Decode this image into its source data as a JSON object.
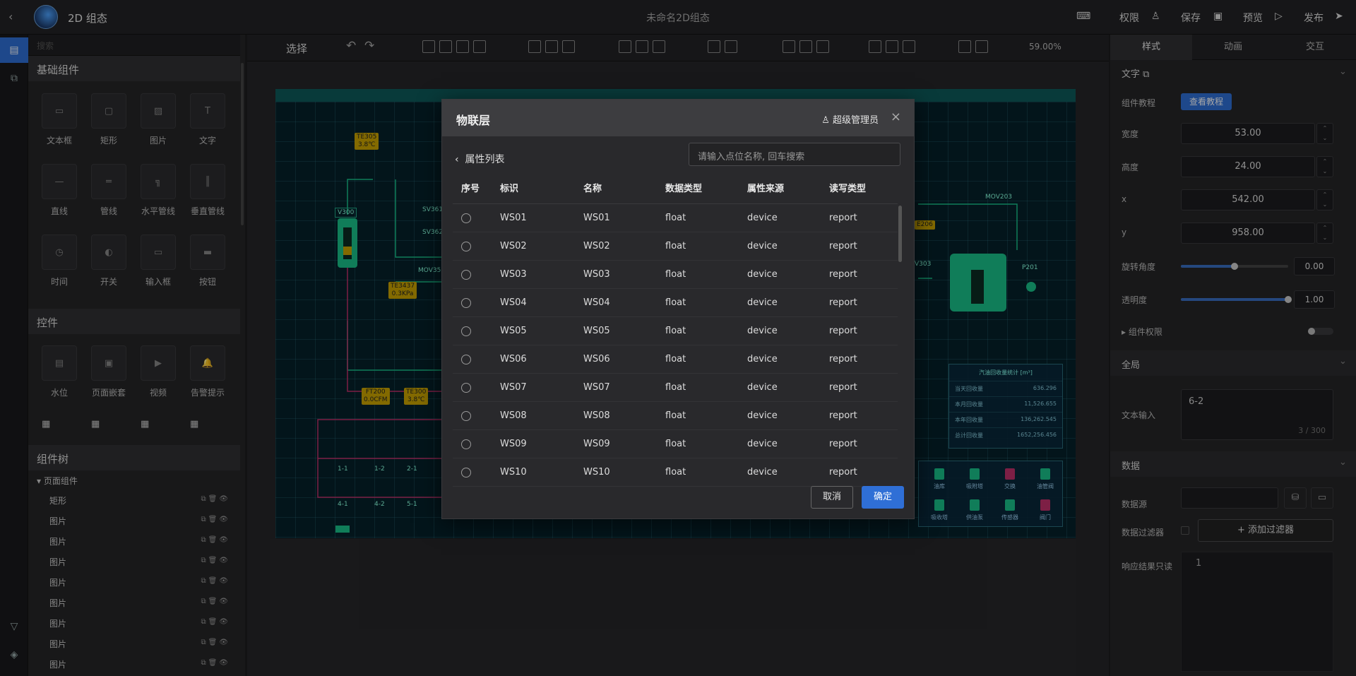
{
  "topbar": {
    "app_title": "2D 组态",
    "doc_title": "未命名2D组态",
    "permissions": "权限",
    "save": "保存",
    "preview": "预览",
    "publish": "发布"
  },
  "left": {
    "search_placeholder": "搜索",
    "basic_title": "基础组件",
    "basic_items": [
      "文本框",
      "矩形",
      "图片",
      "文字",
      "直线",
      "管线",
      "水平管线",
      "垂直管线",
      "时间",
      "开关",
      "输入框",
      "按钮"
    ],
    "controls_title": "控件",
    "control_items": [
      "水位",
      "页面嵌套",
      "视频",
      "告警提示"
    ],
    "tree_title": "组件树",
    "tree_root": "页面组件",
    "tree_items": [
      "矩形",
      "图片",
      "图片",
      "图片",
      "图片",
      "图片",
      "图片",
      "图片",
      "图片"
    ]
  },
  "toolbar": {
    "select_label": "选择",
    "zoom": "59.00%"
  },
  "canvas": {
    "tags": [
      {
        "text": "TE305\n3.8℃"
      },
      {
        "text": "TE3437\n0.3KPa"
      },
      {
        "text": "FT200\n0.0CFM"
      },
      {
        "text": "TE300\n3.8℃"
      }
    ],
    "labels": {
      "v300": "V300",
      "sv361": "SV361",
      "sv362": "SV362",
      "mov35": "MOV35",
      "mov203": "MOV203",
      "v303": "V303",
      "p201": "P201",
      "e206": "E206",
      "pipe_a1": "1-1",
      "pipe_a2": "1-2",
      "pipe_a3": "2-1",
      "pipe_b1": "4-1",
      "pipe_b2": "4-2",
      "pipe_b3": "5-1"
    },
    "stats": {
      "title": "汽油回收量统计 [m³]",
      "rows": [
        {
          "k": "当天回收量",
          "v": "636.296"
        },
        {
          "k": "本月回收量",
          "v": "11,526.655"
        },
        {
          "k": "本年回收量",
          "v": "136,262.545"
        },
        {
          "k": "总计回收量",
          "v": "1652,256.456"
        }
      ]
    },
    "legend": [
      "油库",
      "吸附塔",
      "交换",
      "油管阀",
      "吸收塔",
      "供油泵",
      "传感器",
      "阀门"
    ]
  },
  "right": {
    "tabs": [
      "样式",
      "动画",
      "交互"
    ],
    "text_section": "文字",
    "tutorial_label": "组件教程",
    "tutorial_btn": "查看教程",
    "width_label": "宽度",
    "width_val": "53.00",
    "height_label": "高度",
    "height_val": "24.00",
    "x_label": "x",
    "x_val": "542.00",
    "y_label": "y",
    "y_val": "958.00",
    "rotation_label": "旋转角度",
    "rotation_val": "0.00",
    "opacity_label": "透明度",
    "opacity_val": "1.00",
    "rotation_fraction": 0.5,
    "opacity_fraction": 1.0,
    "perm_label": "组件权限",
    "global_section": "全局",
    "text_input_label": "文本输入",
    "text_input_val": "6-2",
    "text_counter": "3 / 300",
    "data_section": "数据",
    "datasource_label": "数据源",
    "filter_label": "数据过滤器",
    "add_filter": "+ 添加过滤器",
    "readonly_label": "响应结果只读",
    "line_no": "1"
  },
  "modal": {
    "title": "物联层",
    "user": "超级管理员",
    "back_label": "属性列表",
    "search_placeholder": "请输入点位名称, 回车搜索",
    "columns": [
      "序号",
      "标识",
      "名称",
      "数据类型",
      "属性来源",
      "读写类型"
    ],
    "rows": [
      {
        "id": "WS01",
        "name": "WS01",
        "type": "float",
        "source": "device",
        "rw": "report"
      },
      {
        "id": "WS02",
        "name": "WS02",
        "type": "float",
        "source": "device",
        "rw": "report"
      },
      {
        "id": "WS03",
        "name": "WS03",
        "type": "float",
        "source": "device",
        "rw": "report"
      },
      {
        "id": "WS04",
        "name": "WS04",
        "type": "float",
        "source": "device",
        "rw": "report"
      },
      {
        "id": "WS05",
        "name": "WS05",
        "type": "float",
        "source": "device",
        "rw": "report"
      },
      {
        "id": "WS06",
        "name": "WS06",
        "type": "float",
        "source": "device",
        "rw": "report"
      },
      {
        "id": "WS07",
        "name": "WS07",
        "type": "float",
        "source": "device",
        "rw": "report"
      },
      {
        "id": "WS08",
        "name": "WS08",
        "type": "float",
        "source": "device",
        "rw": "report"
      },
      {
        "id": "WS09",
        "name": "WS09",
        "type": "float",
        "source": "device",
        "rw": "report"
      },
      {
        "id": "WS10",
        "name": "WS10",
        "type": "float",
        "source": "device",
        "rw": "report"
      }
    ],
    "cancel": "取消",
    "ok": "确定"
  },
  "colors": {
    "accent": "#2f6fd6",
    "canvas_bg": "#06212a",
    "tag_yellow": "#c9a400",
    "equip_green": "#19c089"
  }
}
